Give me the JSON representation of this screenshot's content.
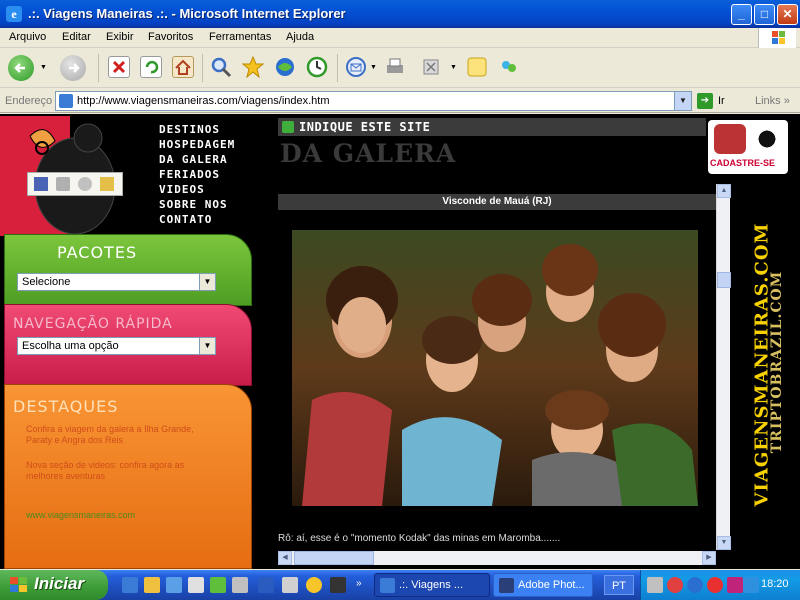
{
  "window": {
    "title": ".:. Viagens Maneiras .:. - Microsoft Internet Explorer",
    "controls": [
      "_",
      "□",
      "✕"
    ]
  },
  "menubar": {
    "items": [
      "Arquivo",
      "Editar",
      "Exibir",
      "Favoritos",
      "Ferramentas",
      "Ajuda"
    ]
  },
  "toolbar": {
    "icons": [
      "back-icon",
      "forward-icon",
      "stop-icon",
      "refresh-icon",
      "home-icon",
      "search-icon",
      "favorites-icon",
      "media-icon",
      "history-icon",
      "mail-icon",
      "print-icon",
      "edit-icon",
      "discuss-icon",
      "messenger-icon"
    ]
  },
  "addressbar": {
    "label": "Endereço",
    "url": "http://www.viagensmaneiras.com/viagens/index.htm",
    "go_label": "Ir",
    "links_label": "Links",
    "more": "»"
  },
  "site": {
    "nav": [
      "DESTINOS",
      "HOSPEDAGEM",
      "DA GALERA",
      "FERIADOS",
      "VIDEOS",
      "SOBRE NOS",
      "CONTATO"
    ],
    "pacotes": {
      "title": "PACOTES",
      "select_value": "Selecione"
    },
    "navegacao": {
      "title": "NAVEGAÇÃO RÁPIDA",
      "select_value": "Escolha uma opção"
    },
    "destaques": {
      "title": "DESTAQUES",
      "items": [
        "Confira a viagem da galera a Ilha Grande, Paraty e Angra dos Reis",
        "Nova seção de videos: confira agora as melhores aventuras",
        "www.viagensmaneiras.com"
      ]
    },
    "indique": "INDIQUE ESTE SITE",
    "section_title": "DA GALERA",
    "cadastre": "CADASTRE-SE",
    "photo_caption_top": "Visconde de Mauá (RJ)",
    "caption": "Rô: aí, esse é o \"momento Kodak\" das minas em Maromba.......",
    "vertical_brand_1": "VIAGENSMANEIRAS.COM",
    "vertical_brand_2": "TRIPTOBRAZIL.COM"
  },
  "taskbar": {
    "start_label": "Iniciar",
    "tasks": [
      {
        "label": ".:. Viagens ...",
        "active": true
      },
      {
        "label": "Adobe Phot...",
        "active": false
      }
    ],
    "language": "PT",
    "clock": "18:20"
  },
  "colors": {
    "pacotes": "#5aaa2a",
    "navegacao": "#e0335f",
    "destaques": "#f07a1a",
    "logo_red": "#d81f3c",
    "indique_bar": "#3b3b3b",
    "xp_blue": "#245edb"
  }
}
